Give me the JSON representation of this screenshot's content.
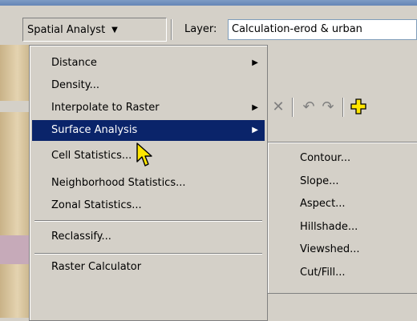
{
  "toolbar": {
    "spatial_analyst_label": "Spatial Analyst",
    "layer_label": "Layer:",
    "layer_value": "Calculation-erod & urban"
  },
  "menu": {
    "items": [
      {
        "label": "Distance",
        "submenu": true
      },
      {
        "label": "Density..."
      },
      {
        "label": "Interpolate to Raster",
        "submenu": true
      },
      {
        "label": "Surface Analysis",
        "submenu": true,
        "highlighted": true
      },
      {
        "label": "Cell Statistics..."
      },
      {
        "label": "Neighborhood Statistics..."
      },
      {
        "label": "Zonal Statistics..."
      },
      {
        "label": "Reclassify..."
      },
      {
        "label": "Raster Calculator"
      }
    ]
  },
  "submenu": {
    "items": [
      {
        "label": "Contour..."
      },
      {
        "label": "Slope..."
      },
      {
        "label": "Aspect..."
      },
      {
        "label": "Hillshade..."
      },
      {
        "label": "Viewshed..."
      },
      {
        "label": "Cut/Fill..."
      }
    ]
  },
  "icons": {
    "submenu_arrow": "right-triangle-icon",
    "dropdown_arrow": "down-triangle-icon",
    "tb_delete": "x-icon",
    "tb_undo": "undo-icon",
    "tb_redo": "redo-icon",
    "tb_add": "add-data-icon",
    "cursor": "pointer-cursor-icon"
  },
  "colors": {
    "menu_bg": "#d4d0c8",
    "highlight": "#0a246a",
    "highlight_text": "#ffffff",
    "add_icon": "#ffe600"
  }
}
